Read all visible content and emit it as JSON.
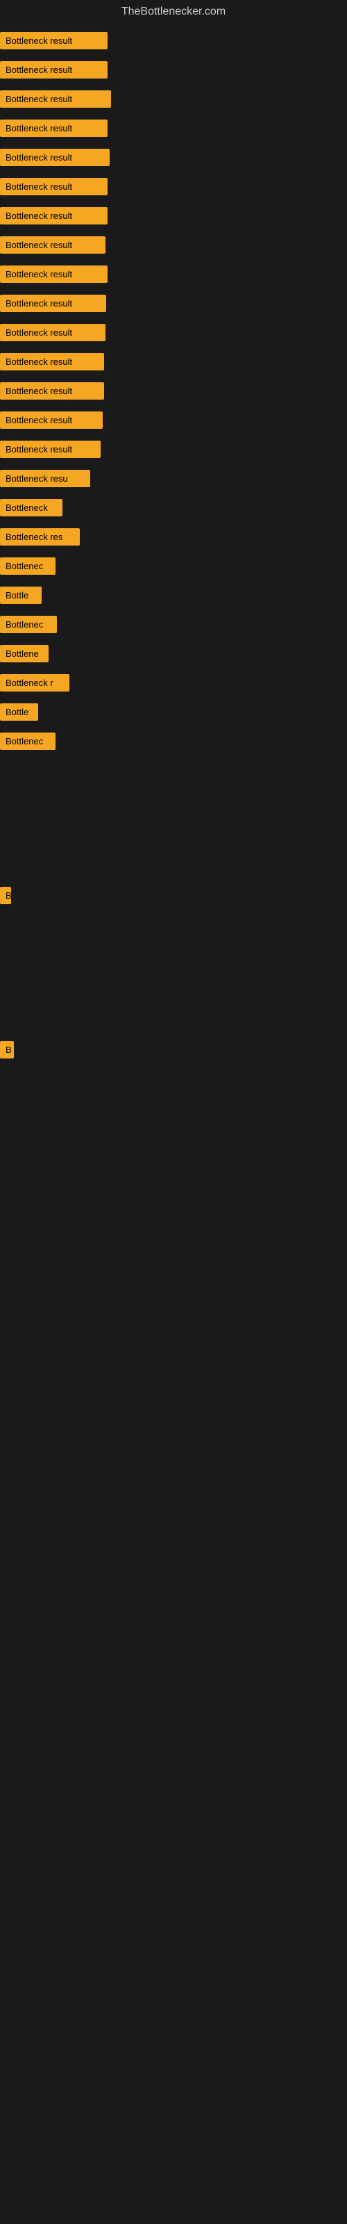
{
  "site": {
    "title": "TheBottlenecker.com"
  },
  "items": [
    {
      "id": 0,
      "label": "Bottleneck result"
    },
    {
      "id": 1,
      "label": "Bottleneck result"
    },
    {
      "id": 2,
      "label": "Bottleneck result"
    },
    {
      "id": 3,
      "label": "Bottleneck result"
    },
    {
      "id": 4,
      "label": "Bottleneck result"
    },
    {
      "id": 5,
      "label": "Bottleneck result"
    },
    {
      "id": 6,
      "label": "Bottleneck result"
    },
    {
      "id": 7,
      "label": "Bottleneck result"
    },
    {
      "id": 8,
      "label": "Bottleneck result"
    },
    {
      "id": 9,
      "label": "Bottleneck result"
    },
    {
      "id": 10,
      "label": "Bottleneck result"
    },
    {
      "id": 11,
      "label": "Bottleneck result"
    },
    {
      "id": 12,
      "label": "Bottleneck result"
    },
    {
      "id": 13,
      "label": "Bottleneck result"
    },
    {
      "id": 14,
      "label": "Bottleneck result"
    },
    {
      "id": 15,
      "label": "Bottleneck resu"
    },
    {
      "id": 16,
      "label": "Bottleneck"
    },
    {
      "id": 17,
      "label": "Bottleneck res"
    },
    {
      "id": 18,
      "label": "Bottlenec"
    },
    {
      "id": 19,
      "label": "Bottle"
    },
    {
      "id": 20,
      "label": "Bottlenec"
    },
    {
      "id": 21,
      "label": "Bottlene"
    },
    {
      "id": 22,
      "label": "Bottleneck r"
    },
    {
      "id": 23,
      "label": "Bottle"
    },
    {
      "id": 24,
      "label": "Bottlenec"
    },
    {
      "id": 25,
      "label": "B"
    },
    {
      "id": 26,
      "label": "B"
    }
  ],
  "colors": {
    "label_bg": "#f5a623",
    "label_text": "#000000",
    "site_text": "#cccccc",
    "background": "#1a1a1a"
  }
}
